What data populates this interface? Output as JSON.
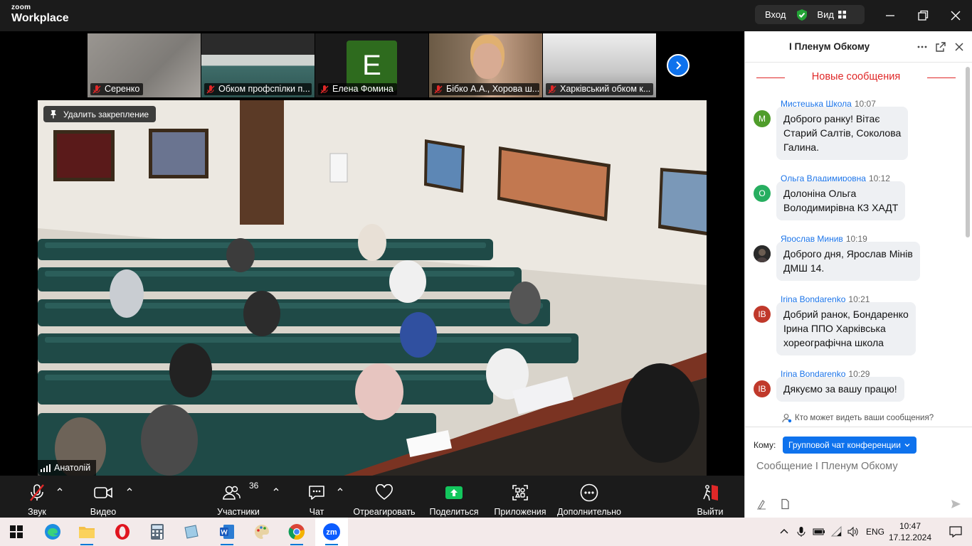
{
  "app": {
    "brand_small": "zoom",
    "brand_big": "Workplace"
  },
  "titlebar": {
    "enter_label": "Вход",
    "view_label": "Вид"
  },
  "participants_strip": [
    {
      "name": "Серенко"
    },
    {
      "name": "Обком профспілки п..."
    },
    {
      "name": "Елена Фомина",
      "initial": "E",
      "avatar_color": "#2e6b1e"
    },
    {
      "name": "Бібко А.А., Хорова ш..."
    },
    {
      "name": "Харківський обком к..."
    }
  ],
  "main_video": {
    "unpin_label": "Удалить закрепление",
    "speaker_name": "Анатолій"
  },
  "toolbar": {
    "audio_label": "Звук",
    "video_label": "Видео",
    "participants_label": "Участники",
    "participants_count": "36",
    "chat_label": "Чат",
    "react_label": "Отреагировать",
    "share_label": "Поделиться",
    "apps_label": "Приложения",
    "more_label": "Дополнительно",
    "leave_label": "Выйти"
  },
  "chat": {
    "title": "І Пленум Обкому",
    "new_messages_label": "Новые сообщения",
    "messages": [
      {
        "sender": "Мистецька Школа",
        "time": "10:07",
        "initials": "M",
        "avatar_color": "#4f9d2b",
        "lines": [
          "Доброго ранку! Вітає",
          "Старий Салтів, Соколова",
          "Галина."
        ]
      },
      {
        "sender": "Ольга  Владимировна",
        "time": "10:12",
        "initials": "O",
        "avatar_color": "#27ae60",
        "lines": [
          "Долоніна Ольга",
          "Володимирівна КЗ ХАДТ"
        ]
      },
      {
        "sender": "Ярослав Минив",
        "time": "10:19",
        "initials": "",
        "avatar_color": "#2a2a2a",
        "lines": [
          "Доброго дня, Ярослав Мінів",
          "ДМШ 14."
        ]
      },
      {
        "sender": "Irina Bondarenko",
        "time": "10:21",
        "initials": "IB",
        "avatar_color": "#c0392b",
        "lines": [
          "Добрий ранок, Бондаренко",
          "Ірина ППО Харківська",
          "хореографічна школа"
        ]
      },
      {
        "sender": "Irina Bondarenko",
        "time": "10:29",
        "initials": "IB",
        "avatar_color": "#c0392b",
        "lines": [
          "Дякуємо за вашу працю!"
        ]
      }
    ],
    "who_can_see": "Кто может видеть ваши сообщения?",
    "to_label": "Кому:",
    "to_value": "Групповой чат конференции",
    "input_placeholder": "Сообщение І Пленум Обкому"
  },
  "taskbar": {
    "language": "ENG",
    "time": "10:47",
    "date": "17.12.2024"
  },
  "colors": {
    "accent": "#0e72ed",
    "new_messages": "#e02828",
    "share_green": "#13c65d",
    "leave_red": "#e02828"
  }
}
